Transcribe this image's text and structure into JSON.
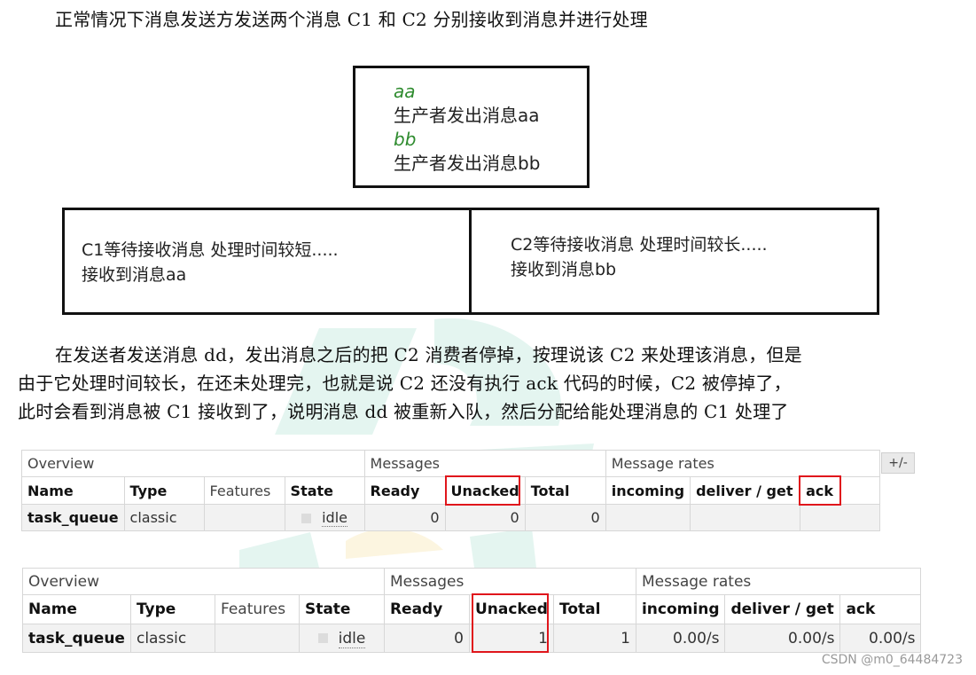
{
  "intro": "正常情况下消息发送方发送两个消息 C1 和 C2 分别接收到消息并进行处理",
  "producer_console": {
    "lines": [
      {
        "text": "aa",
        "style": "input"
      },
      {
        "text": "生产者发出消息aa",
        "style": "output"
      },
      {
        "text": "bb",
        "style": "input"
      },
      {
        "text": "生产者发出消息bb",
        "style": "output"
      }
    ]
  },
  "consumers": {
    "c1": {
      "line1": "C1等待接收消息 处理时间较短.....",
      "line2": "接收到消息aa"
    },
    "c2": {
      "line1": "C2等待接收消息 处理时间较长.....",
      "line2": "接收到消息bb"
    }
  },
  "explanation": [
    "在发送者发送消息 dd，发出消息之后的把 C2 消费者停掉，按理说该 C2 来处理该消息，但是",
    "由于它处理时间较长，在还未处理完，也就是说 C2 还没有执行 ack 代码的时候，C2 被停掉了，",
    "此时会看到消息被 C1 接收到了，说明消息 dd 被重新入队，然后分配给能处理消息的 C1 处理了"
  ],
  "table_top": {
    "groups": [
      "Overview",
      "Messages",
      "Message rates"
    ],
    "headers": [
      "Name",
      "Type",
      "Features",
      "State",
      "Ready",
      "Unacked",
      "Total",
      "incoming",
      "deliver / get",
      "ack"
    ],
    "row": {
      "name": "task_queue",
      "type": "classic",
      "features": "",
      "state": "idle",
      "ready": "0",
      "unacked": "0",
      "total": "0",
      "incoming": "",
      "deliver_get": "",
      "ack": ""
    },
    "toggle": "+/-"
  },
  "table_bottom": {
    "groups": [
      "Overview",
      "Messages",
      "Message rates"
    ],
    "headers": [
      "Name",
      "Type",
      "Features",
      "State",
      "Ready",
      "Unacked",
      "Total",
      "incoming",
      "deliver / get",
      "ack"
    ],
    "row": {
      "name": "task_queue",
      "type": "classic",
      "features": "",
      "state": "idle",
      "ready": "0",
      "unacked": "1",
      "total": "1",
      "incoming": "0.00/s",
      "deliver_get": "0.00/s",
      "ack": "0.00/s"
    }
  },
  "watermark_credit": "CSDN @m0_64484723",
  "colors": {
    "highlight": "#e0161c",
    "console_input": "#2e8b2e",
    "watermark": "#6ec9b0"
  }
}
